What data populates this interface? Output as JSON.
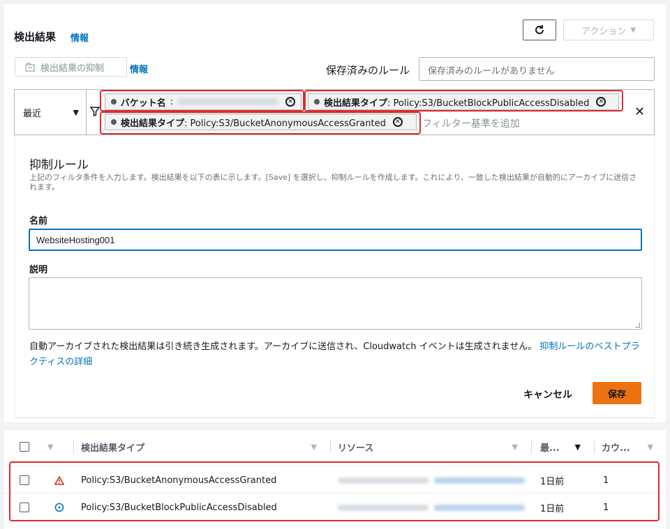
{
  "header": {
    "title": "検出結果",
    "info": "情報",
    "actions_label": "アクション"
  },
  "suppress": {
    "button_label": "検出結果の抑制",
    "info": "情報"
  },
  "saved_rules": {
    "label": "保存済みのルール",
    "placeholder": "保存済みのルールがありません"
  },
  "filter": {
    "recent_label": "最近",
    "add_placeholder": "フィルター基準を追加",
    "tokens": [
      {
        "key": "バケット名",
        "value": ""
      },
      {
        "key": "検出結果タイプ",
        "value": ": Policy:S3/BucketBlockPublicAccessDisabled"
      },
      {
        "key": "検出結果タイプ",
        "value": ": Policy:S3/BucketAnonymousAccessGranted"
      }
    ]
  },
  "form": {
    "title": "抑制ルール",
    "description": "上記のフィルタ条件を入力します。検出結果を以下の表に示します。[Save] を選択し、抑制ルールを作成します。これにより、一致した検出結果が自動的にアーカイブに送信されます。",
    "name_label": "名前",
    "name_value": "WebsiteHosting001",
    "desc_label": "説明",
    "desc_value": "",
    "note": "自動アーカイブされた検出結果は引き続き生成されます。アーカイブに送信され、Cloudwatch イベントは生成されません。",
    "note_link": "抑制ルールのベストプラクティスの詳細",
    "cancel_label": "キャンセル",
    "save_label": "保存"
  },
  "table": {
    "columns": [
      "検出結果タイプ",
      "リソース",
      "最...",
      "カウ..."
    ],
    "rows": [
      {
        "type": "Policy:S3/BucketAnonymousAccessGranted",
        "icon": "warning-triangle-icon",
        "icon_color": "#d13212",
        "last": "1日前",
        "count": "1"
      },
      {
        "type": "Policy:S3/BucketBlockPublicAccessDisabled",
        "icon": "info-circle-icon",
        "icon_color": "#0073bb",
        "last": "1日前",
        "count": "1"
      }
    ]
  },
  "colors": {
    "accent": "#0073bb",
    "primary_button": "#ec7211",
    "highlight": "#e02b2b"
  }
}
